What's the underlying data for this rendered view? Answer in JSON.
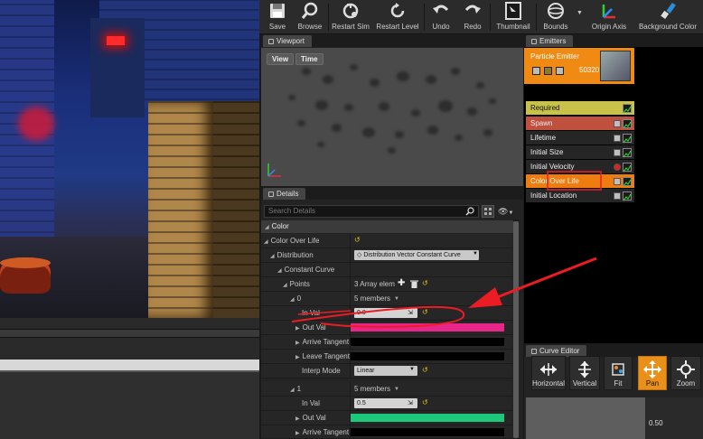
{
  "toolbar": {
    "items": [
      {
        "label": "Save",
        "icon": "save-icon"
      },
      {
        "label": "Browse",
        "icon": "browse-icon"
      },
      {
        "label": "Restart Sim",
        "icon": "restart-sim-icon"
      },
      {
        "label": "Restart Level",
        "icon": "restart-level-icon"
      },
      {
        "label": "Undo",
        "icon": "undo-icon"
      },
      {
        "label": "Redo",
        "icon": "redo-icon"
      },
      {
        "label": "Thumbnail",
        "icon": "thumbnail-icon"
      },
      {
        "label": "Bounds",
        "icon": "bounds-icon"
      },
      {
        "label": "Origin Axis",
        "icon": "origin-axis-icon"
      },
      {
        "label": "Background Color",
        "icon": "background-color-icon"
      }
    ]
  },
  "viewport": {
    "tab": "Viewport",
    "buttons": {
      "view": "View",
      "time": "Time"
    }
  },
  "details": {
    "tab": "Details",
    "search_placeholder": "Search Details",
    "category": "Color",
    "rows": {
      "color_over_life": "Color Over Life",
      "distribution": "Distribution",
      "distribution_value": "Distribution Vector Constant Curve",
      "constant_curve": "Constant Curve",
      "points": "Points",
      "points_value": "3 Array elem",
      "p0": "0",
      "p0_members": "5 members",
      "in_val": "In Val",
      "in_val_0": "0.0",
      "out_val": "Out Val",
      "arrive_tangent": "Arrive Tangent",
      "leave_tangent": "Leave Tangent",
      "interp_mode": "Interp Mode",
      "interp_value": "Linear",
      "p1": "1",
      "p1_members": "5 members",
      "in_val_1": "0.5"
    },
    "colors": {
      "out_val_0": "#e8268a",
      "out_val_1": "#1ec87a"
    }
  },
  "emitters": {
    "tab": "Emitters",
    "emitter_name": "Particle Emitter",
    "emitter_count": "50320",
    "modules": [
      {
        "label": "Required",
        "bg": "#c8c24a",
        "text": "#111111"
      },
      {
        "label": "Spawn",
        "bg": "#c0503e",
        "text": "#eeeeee"
      },
      {
        "label": "Lifetime",
        "bg": "#262626",
        "text": "#eeeeee"
      },
      {
        "label": "Initial Size",
        "bg": "#262626",
        "text": "#eeeeee"
      },
      {
        "label": "Initial Velocity",
        "bg": "#262626",
        "text": "#eeeeee"
      },
      {
        "label": "Color Over Life",
        "bg": "#ee7c0e",
        "text": "#ffffff"
      },
      {
        "label": "Initial Location",
        "bg": "#262626",
        "text": "#eeeeee"
      }
    ]
  },
  "curve_editor": {
    "tab": "Curve Editor",
    "buttons": [
      {
        "label": "Horizontal",
        "icon": "fit-horizontal-icon"
      },
      {
        "label": "Vertical",
        "icon": "fit-vertical-icon"
      },
      {
        "label": "Fit",
        "icon": "fit-icon"
      },
      {
        "label": "Pan",
        "icon": "pan-icon"
      },
      {
        "label": "Zoom",
        "icon": "zoom-icon"
      }
    ],
    "axis_value": "0.50"
  }
}
